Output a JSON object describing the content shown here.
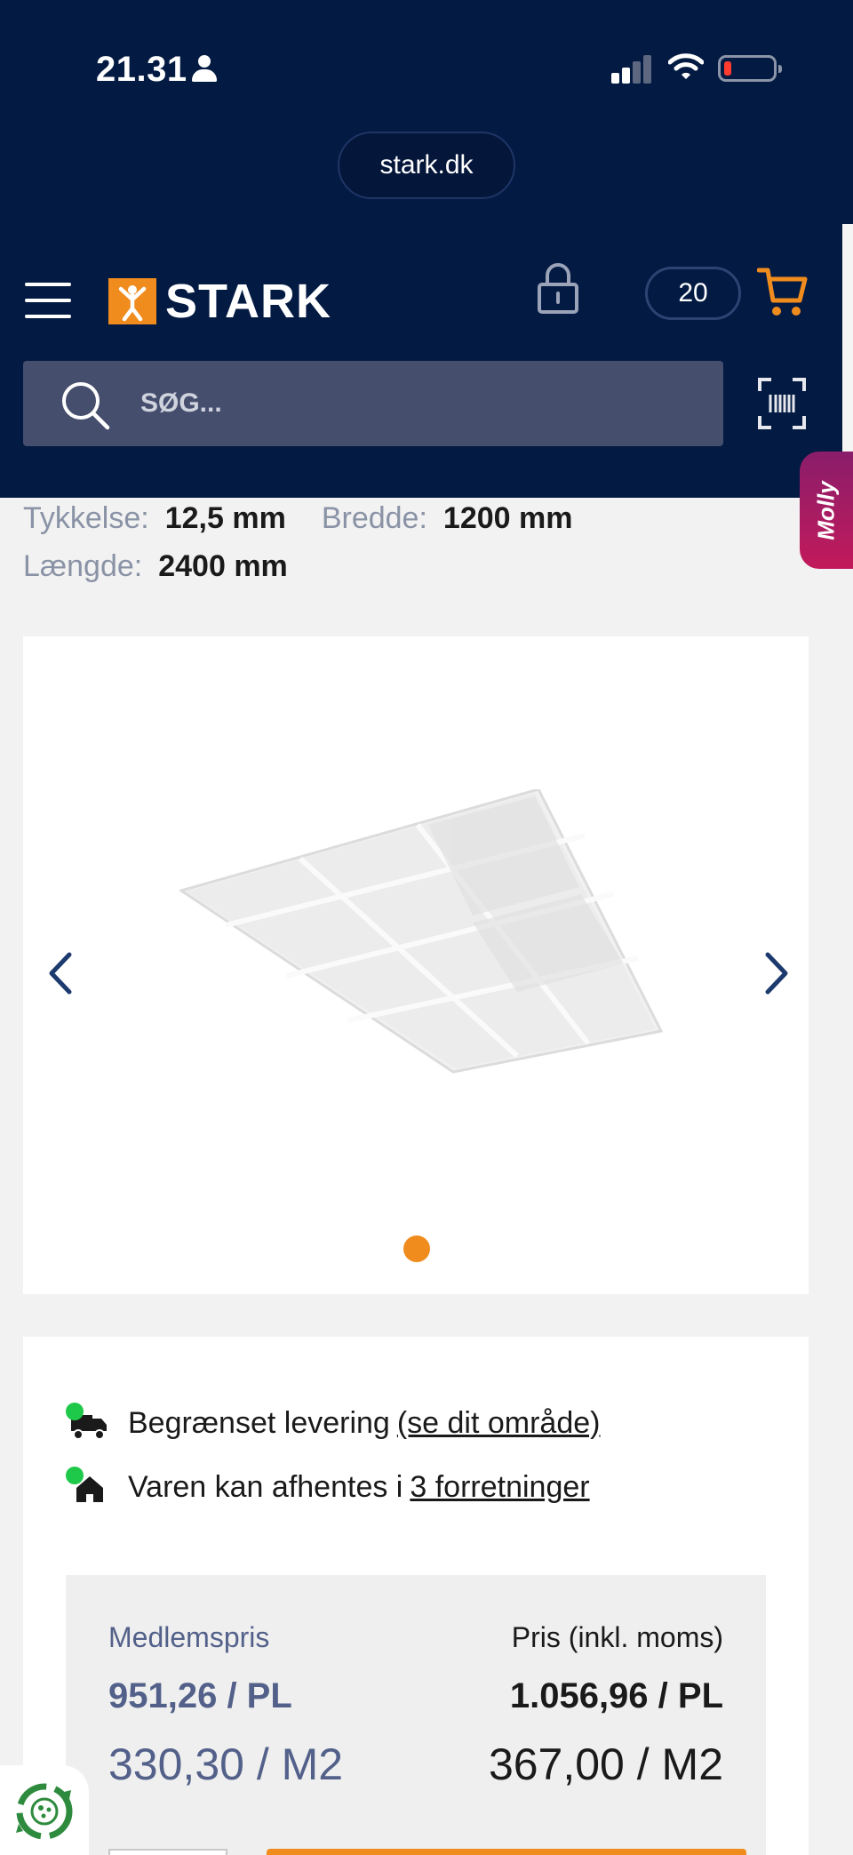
{
  "status_bar": {
    "time": "21.31"
  },
  "browser": {
    "url": "stark.dk"
  },
  "header": {
    "logo_text": "STARK",
    "cart_count": "20",
    "accent_color": "#f08c1e",
    "nav_background": "#031a43"
  },
  "search": {
    "placeholder": "SØG..."
  },
  "chat_widget": {
    "label": "Molly"
  },
  "specs": {
    "thickness_label": "Tykkelse:",
    "thickness_value": "12,5 mm",
    "width_label": "Bredde:",
    "width_value": "1200 mm",
    "length_label": "Længde:",
    "length_value": "2400 mm"
  },
  "gallery": {
    "image_count": 1,
    "active_index": 0
  },
  "availability": {
    "delivery_text": "Begrænset levering",
    "delivery_link": "(se dit område)",
    "pickup_text": "Varen kan afhentes i",
    "pickup_link": "3 forretninger"
  },
  "pricing": {
    "member_label": "Medlemspris",
    "member_price_unit": "951,26 / PL",
    "member_price_m2": "330,30 / M2",
    "regular_label": "Pris (inkl. moms)",
    "regular_price_unit": "1.056,96 / PL",
    "regular_price_m2": "367,00 / M2"
  }
}
